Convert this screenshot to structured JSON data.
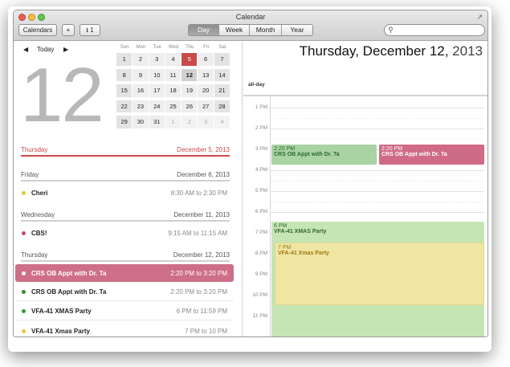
{
  "window": {
    "title": "Calendar"
  },
  "toolbar": {
    "calendars_label": "Calendars",
    "add_label": "+",
    "inbox_label": "1",
    "views": [
      "Day",
      "Week",
      "Month",
      "Year"
    ],
    "active_view": "Day",
    "search_placeholder": ""
  },
  "left": {
    "nav_today": "Today",
    "big_day": "12",
    "mini_cal": {
      "weekdays": [
        "Sun",
        "Mon",
        "Tue",
        "Wed",
        "Thu",
        "Fri",
        "Sat"
      ],
      "weeks": [
        [
          "",
          "",
          "",
          "",
          "5",
          "6",
          "7"
        ],
        [
          "1",
          "2",
          "3",
          "4",
          "5",
          "6",
          "7"
        ],
        [
          "8",
          "9",
          "10",
          "11",
          "12",
          "13",
          "14"
        ],
        [
          "15",
          "16",
          "17",
          "18",
          "19",
          "20",
          "21"
        ],
        [
          "22",
          "23",
          "24",
          "25",
          "26",
          "27",
          "28"
        ],
        [
          "29",
          "30",
          "31",
          "1",
          "2",
          "3",
          "4"
        ]
      ]
    },
    "sections": [
      {
        "day": "Thursday",
        "date": "December 5, 2013",
        "highlight": true,
        "events": []
      },
      {
        "day": "Friday",
        "date": "December 6, 2013",
        "highlight": false,
        "events": [
          {
            "name": "Cheri",
            "time": "8:30 AM to 2:30 PM",
            "color": "#e8c53a"
          }
        ]
      },
      {
        "day": "Wednesday",
        "date": "December 11, 2013",
        "highlight": false,
        "events": [
          {
            "name": "CBS!",
            "time": "9:15 AM to 11:15 AM",
            "color": "#c94a6e"
          }
        ]
      },
      {
        "day": "Thursday",
        "date": "December 12, 2013",
        "highlight": false,
        "events": [
          {
            "name": "CRS OB Appt with Dr. Ta",
            "time": "2:20 PM to 3:20 PM",
            "color": "#ffffff",
            "selected": true
          },
          {
            "name": "CRS OB Appt with Dr. Ta",
            "time": "2:20 PM to 3:20 PM",
            "color": "#3a8a3a"
          },
          {
            "name": "VFA-41 XMAS Party",
            "time": "6 PM to 11:59 PM",
            "color": "#3a9a3a"
          },
          {
            "name": "VFA-41 Xmas Party",
            "time": "7 PM to 10 PM",
            "color": "#e8c53a"
          }
        ]
      }
    ]
  },
  "right": {
    "date_bold": "Thursday, December 12,",
    "date_year": " 2013",
    "allday_label": "all-day",
    "hours": [
      "1 PM",
      "2 PM",
      "3 PM",
      "4 PM",
      "5 PM",
      "6 PM",
      "7 PM",
      "8 PM",
      "9 PM",
      "10 PM",
      "11 PM"
    ],
    "blocks": [
      {
        "time": "2:20 PM",
        "title": "CRS OB Appt with Dr. Ta",
        "bg": "#a9d3a3",
        "fg": "#2f6a2f"
      },
      {
        "time": "2:20 PM",
        "title": "CRS OB Appt with Dr. Ta",
        "bg": "#cf6b86",
        "fg": "#ffffff"
      },
      {
        "time": "6 PM",
        "title": "VFA-41 XMAS Party",
        "bg": "#c6e5b4",
        "fg": "#2f6a2f"
      },
      {
        "time": "7 PM",
        "title": "VFA-41 Xmas Party",
        "bg": "#efe6a4",
        "fg": "#a07a10"
      }
    ]
  },
  "colors": {
    "accent": "#c94a4a",
    "today": "#c94a4a"
  }
}
